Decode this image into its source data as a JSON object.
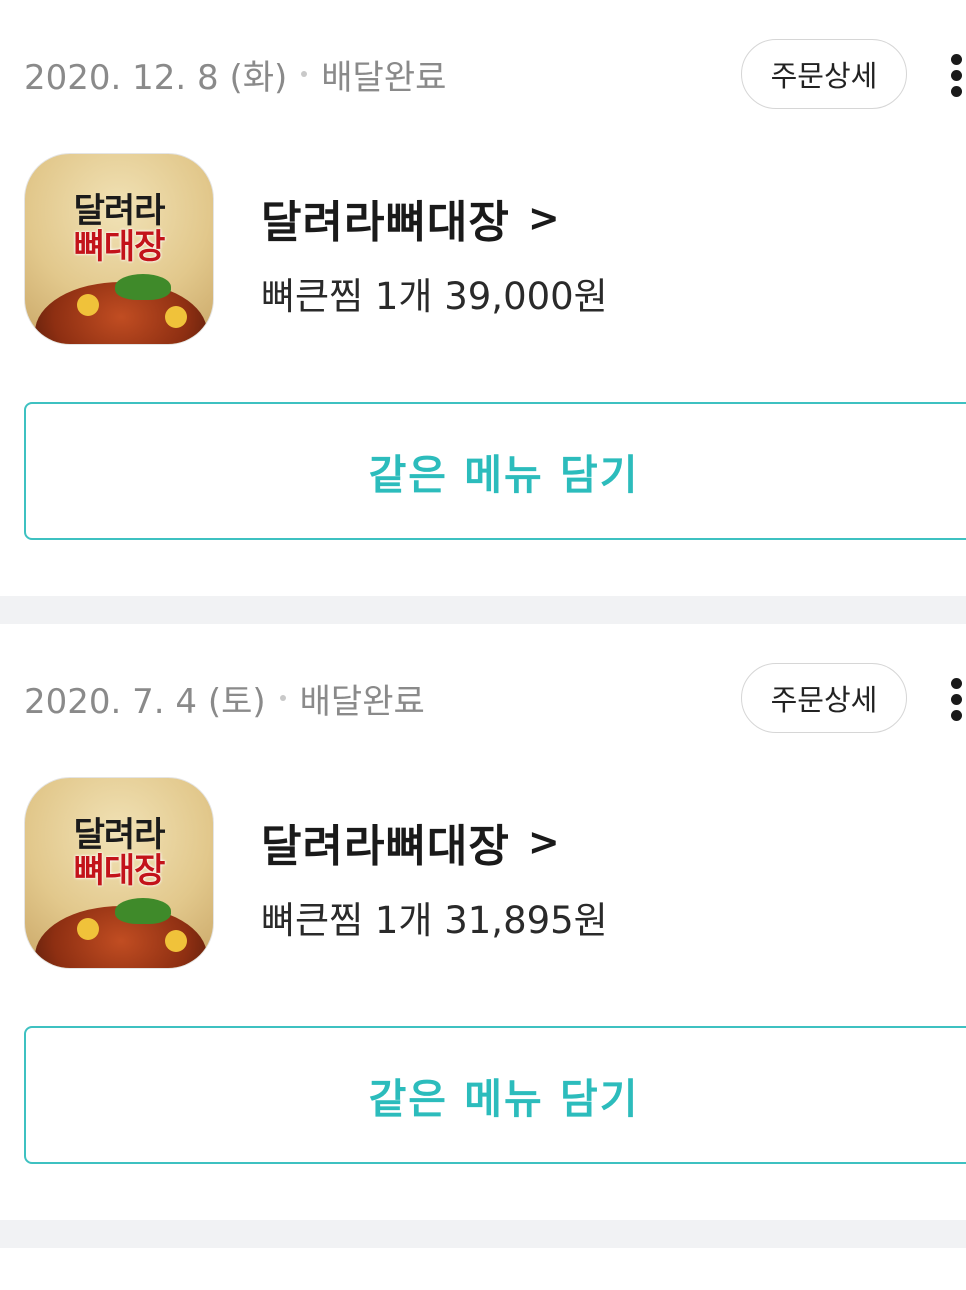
{
  "orders": [
    {
      "date": "2020. 12. 8 (화)",
      "status": "배달완료",
      "detail_label": "주문상세",
      "store_logo_text": [
        "달려라",
        "뼈대장"
      ],
      "store_name": "달려라뼈대장",
      "store_chevron": ">",
      "menu_summary": "뼈큰찜 1개 39,000원",
      "reorder_label": "같은 메뉴 담기"
    },
    {
      "date": "2020. 7. 4 (토)",
      "status": "배달완료",
      "detail_label": "주문상세",
      "store_logo_text": [
        "달려라",
        "뼈대장"
      ],
      "store_name": "달려라뼈대장",
      "store_chevron": ">",
      "menu_summary": "뼈큰찜 1개 31,895원",
      "reorder_label": "같은 메뉴 담기"
    }
  ],
  "icons": {
    "more": "more-vertical-icon",
    "chevron": "chevron-right-icon"
  },
  "colors": {
    "accent": "#2cbcbc",
    "divider": "#f1f2f4",
    "meta_text": "#8a8a8a"
  }
}
